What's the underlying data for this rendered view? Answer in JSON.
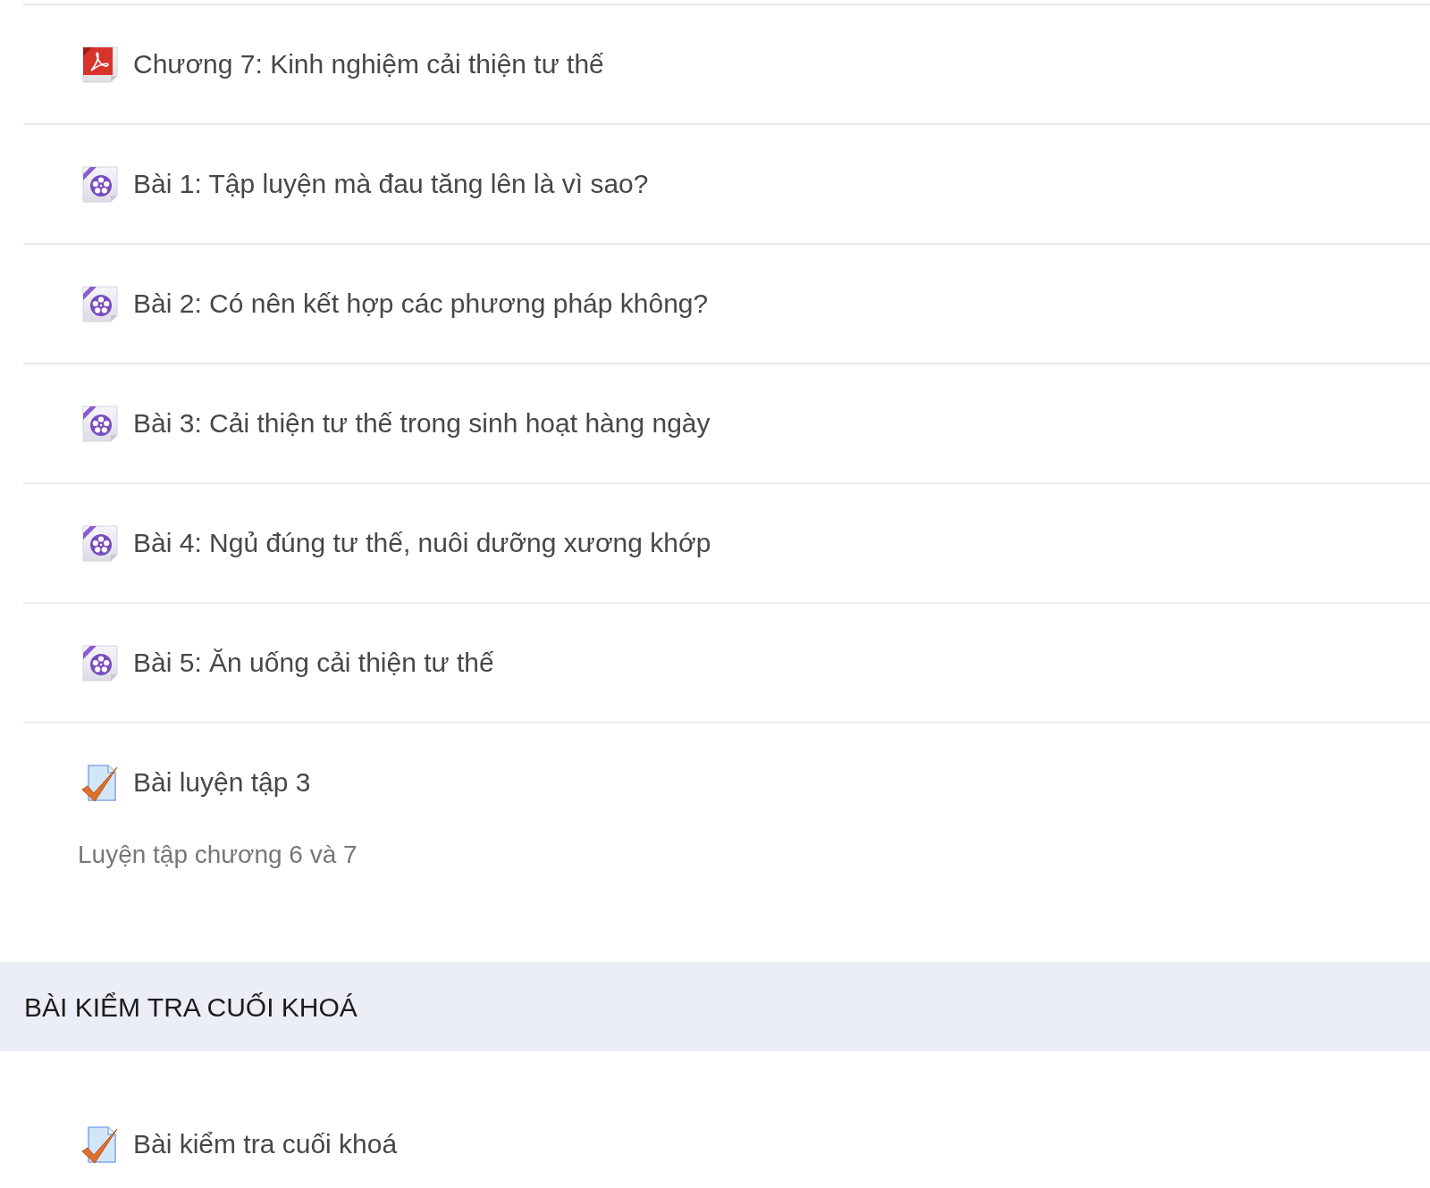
{
  "section": {
    "activities": [
      {
        "kind": "pdf",
        "title": "Chương 7: Kinh nghiệm cải thiện tư thế"
      },
      {
        "kind": "video",
        "title": "Bài 1: Tập luyện mà đau tăng lên là vì sao?"
      },
      {
        "kind": "video",
        "title": "Bài 2: Có nên kết hợp các phương pháp không?"
      },
      {
        "kind": "video",
        "title": "Bài 3: Cải thiện tư thế trong sinh hoạt hàng ngày"
      },
      {
        "kind": "video",
        "title": "Bài 4: Ngủ đúng tư thế, nuôi dưỡng xương khớp"
      },
      {
        "kind": "video",
        "title": "Bài 5: Ăn uống cải thiện tư thế"
      },
      {
        "kind": "quiz",
        "title": "Bài luyện tập 3",
        "description": "Luyện tập chương 6 và 7"
      }
    ]
  },
  "final_section": {
    "title": "BÀI KIỂM TRA CUỐI KHOÁ",
    "activities": [
      {
        "kind": "quiz",
        "title": "Bài kiểm tra cuối khoá"
      }
    ]
  }
}
